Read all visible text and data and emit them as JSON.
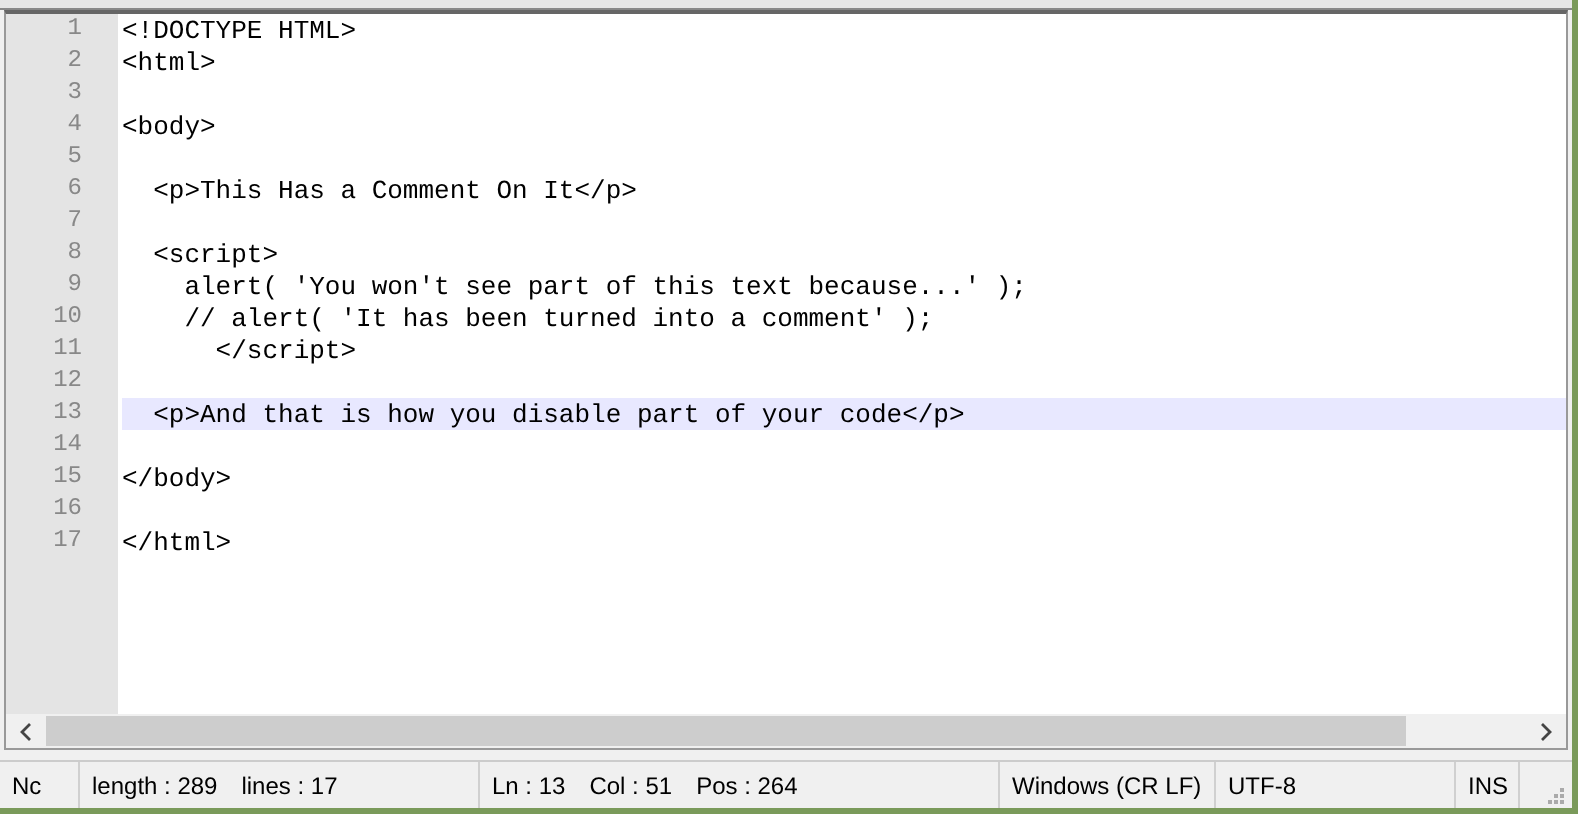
{
  "editor": {
    "lines": [
      {
        "number": "1",
        "text": "<!DOCTYPE HTML>",
        "current": false
      },
      {
        "number": "2",
        "text": "<html>",
        "current": false
      },
      {
        "number": "3",
        "current": false
      },
      {
        "number": "4",
        "text": "<body>",
        "current": false
      },
      {
        "number": "5",
        "current": false
      },
      {
        "number": "6",
        "text": "  <p>This Has a Comment On It</p>",
        "current": false
      },
      {
        "number": "7",
        "current": false
      },
      {
        "number": "8",
        "text": "  <script>",
        "current": false
      },
      {
        "number": "9",
        "text": "    alert( 'You won't see part of this text because...' );",
        "current": false
      },
      {
        "number": "10",
        "text": "    // alert( 'It has been turned into a comment' );",
        "current": false
      },
      {
        "number": "11",
        "text": "      </script>",
        "current": false
      },
      {
        "number": "12",
        "current": false
      },
      {
        "number": "13",
        "text": "  <p>And that is how you disable part of your code</p>",
        "current": true
      },
      {
        "number": "14",
        "current": false
      },
      {
        "number": "15",
        "text": "</body>",
        "current": false
      },
      {
        "number": "16",
        "current": false
      },
      {
        "number": "17",
        "text": "</html>",
        "current": false
      }
    ]
  },
  "status_bar": {
    "sections": [
      {
        "items": [
          "Nc"
        ]
      },
      {
        "items": [
          "length : 289",
          "lines : 17"
        ]
      },
      {
        "items": [
          "Ln : 13",
          "Col : 51",
          "Pos : 264"
        ]
      },
      {
        "items": [
          "Windows (CR LF)"
        ]
      },
      {
        "items": [
          "UTF-8"
        ]
      },
      {
        "items": [
          "INS"
        ]
      }
    ]
  }
}
